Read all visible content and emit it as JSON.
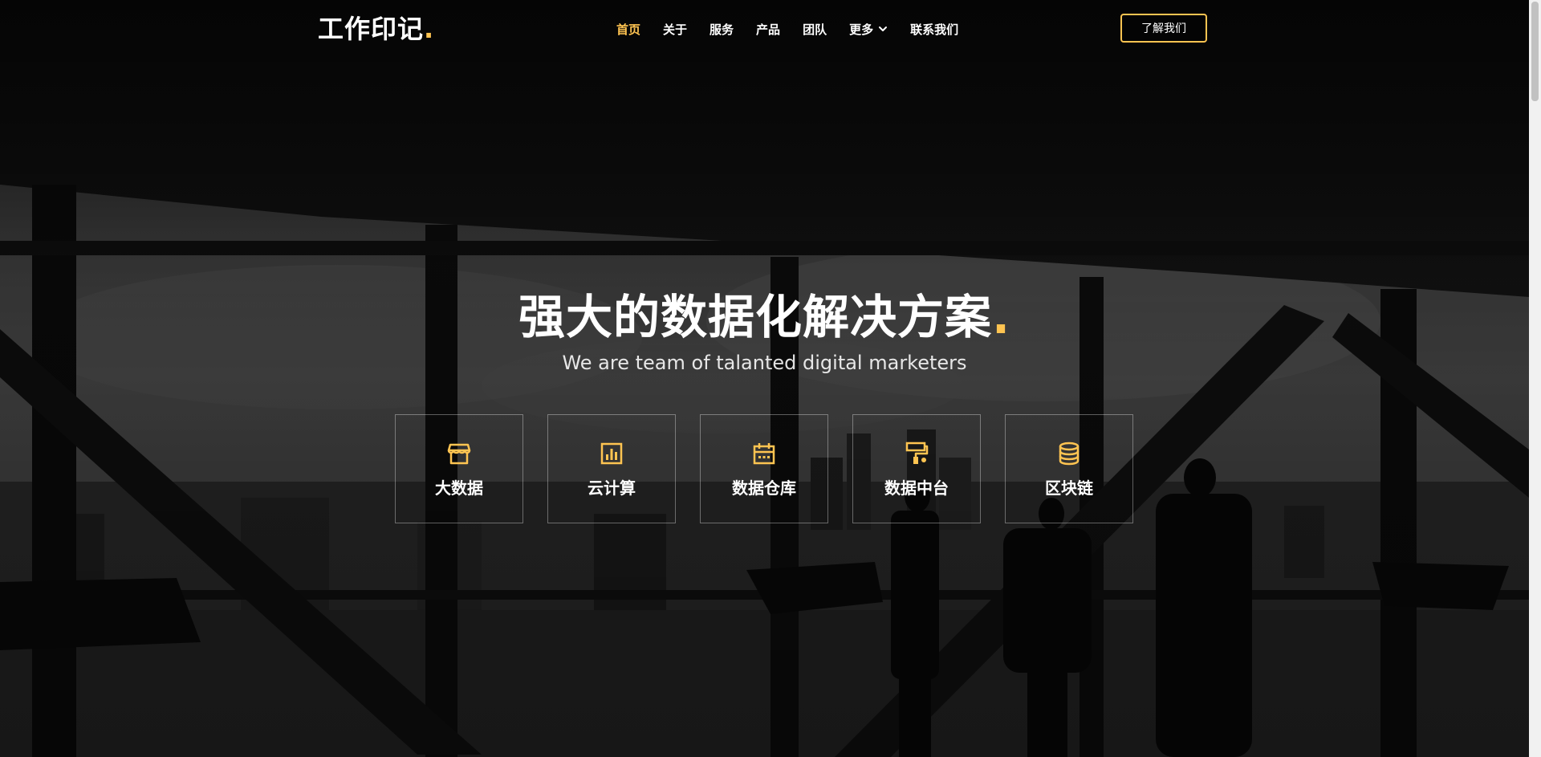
{
  "header": {
    "logo_text": "工作印记",
    "logo_dot": ".",
    "nav": [
      {
        "label": "首页",
        "active": true
      },
      {
        "label": "关于"
      },
      {
        "label": "服务"
      },
      {
        "label": "产品"
      },
      {
        "label": "团队"
      },
      {
        "label": "更多",
        "icon": "chevron-down-icon"
      },
      {
        "label": "联系我们"
      }
    ],
    "cta_label": "了解我们"
  },
  "hero": {
    "title": "强大的数据化解决方案",
    "title_dot": ".",
    "subtitle": "We are team of talanted digital marketers",
    "features": [
      {
        "label": "大数据",
        "icon": "store-icon"
      },
      {
        "label": "云计算",
        "icon": "bar-chart-box-icon"
      },
      {
        "label": "数据仓库",
        "icon": "calendar-icon"
      },
      {
        "label": "数据中台",
        "icon": "paint-roller-icon"
      },
      {
        "label": "区块链",
        "icon": "database-icon"
      }
    ]
  },
  "colors": {
    "accent": "#ffc451",
    "text": "#ffffff",
    "background": "#0c0c0c"
  }
}
